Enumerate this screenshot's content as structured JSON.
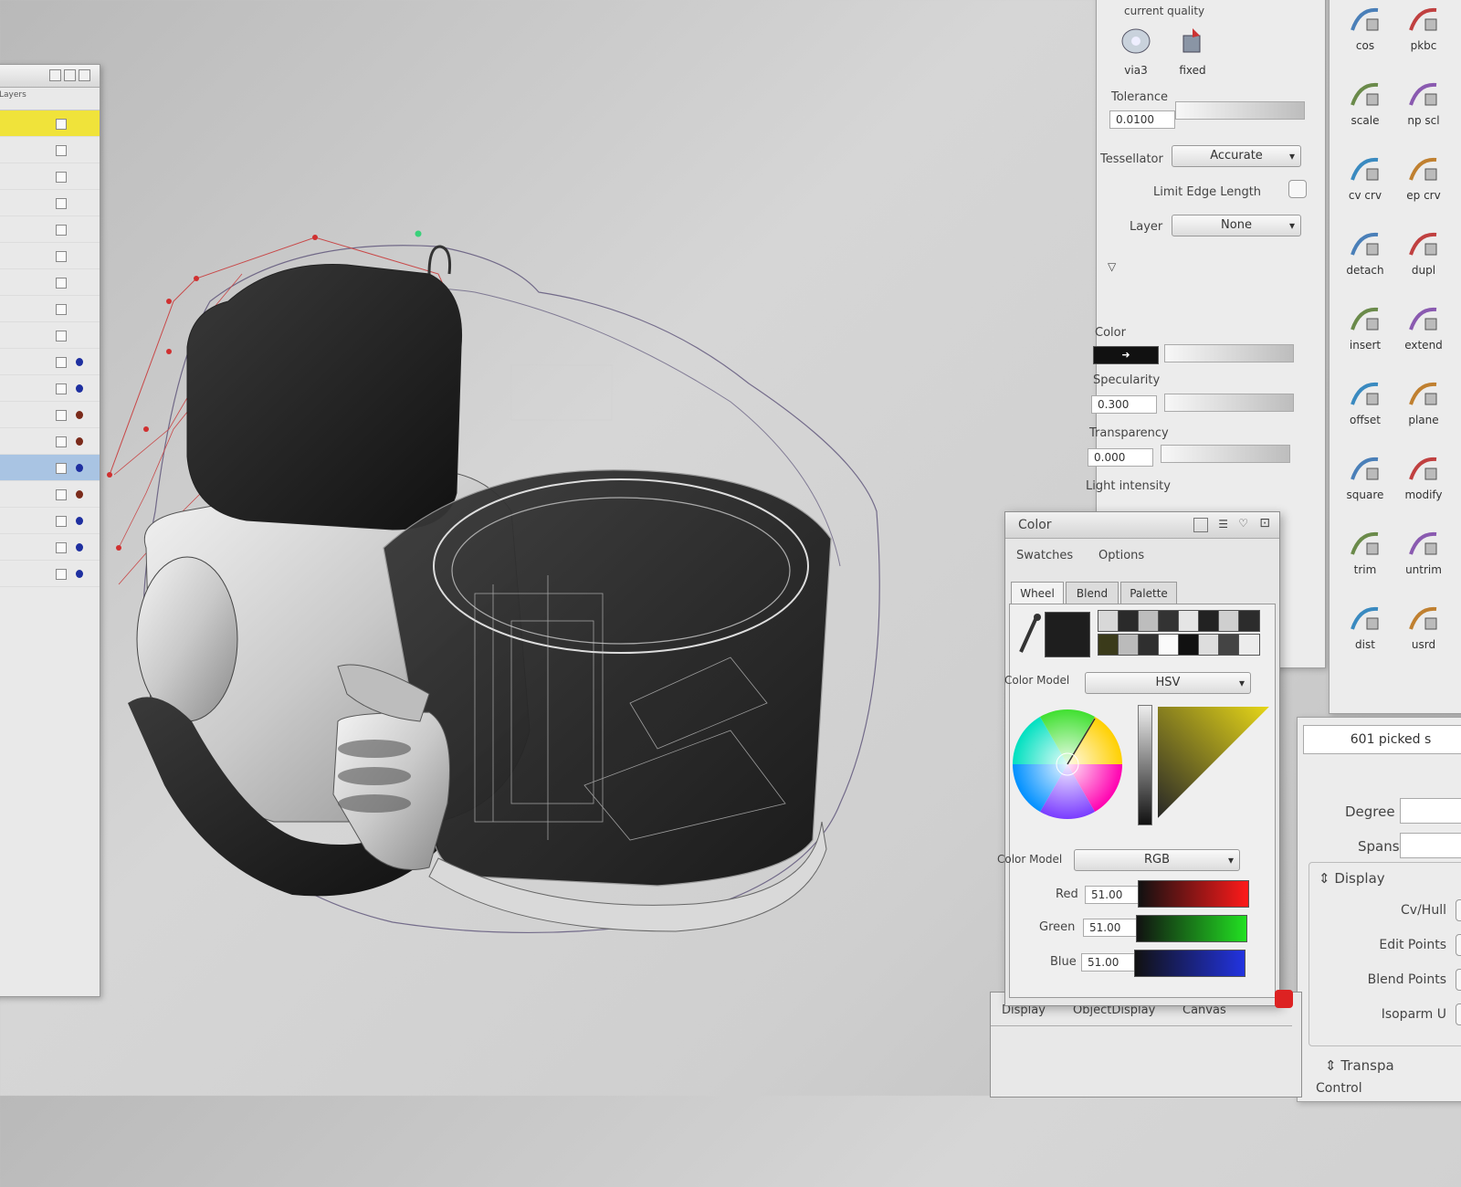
{
  "tessellation": {
    "top_label_partial": "current quality",
    "top_tools": [
      {
        "label": "via3"
      },
      {
        "label": "fixed"
      }
    ],
    "tolerance_label": "Tolerance",
    "tolerance_value": "0.0100",
    "tessellator_label": "Tessellator",
    "tessellator_value": "Accurate",
    "limit_edge_label": "Limit Edge Length",
    "layer_label": "Layer",
    "layer_value": "None"
  },
  "shading": {
    "color_label": "Color",
    "specularity_label": "Specularity",
    "specularity_value": "0.300",
    "transparency_label": "Transparency",
    "transparency_value": "0.000",
    "light_intensity_label": "Light intensity"
  },
  "palette_tools": [
    {
      "label": "cos"
    },
    {
      "label": "pkbc"
    },
    {
      "label": "scale"
    },
    {
      "label": "np scl"
    },
    {
      "label": "cv crv"
    },
    {
      "label": "ep crv"
    },
    {
      "label": "detach"
    },
    {
      "label": "dupl"
    },
    {
      "label": "insert"
    },
    {
      "label": "extend"
    },
    {
      "label": "offset"
    },
    {
      "label": "plane"
    },
    {
      "label": "square"
    },
    {
      "label": "modify"
    },
    {
      "label": "trim"
    },
    {
      "label": "untrim"
    },
    {
      "label": "dist"
    },
    {
      "label": "usrd"
    }
  ],
  "color_window": {
    "title": "Color",
    "menu": [
      "Swatches",
      "Options"
    ],
    "tabs": [
      "Wheel",
      "Blend",
      "Palette"
    ],
    "color_model_label_1": "Color Model",
    "color_model_value_1": "HSV",
    "color_model_label_2": "Color Model",
    "color_model_value_2": "RGB",
    "red_label": "Red",
    "red_value": "51.00",
    "green_label": "Green",
    "green_value": "51.00",
    "blue_label": "Blue",
    "blue_value": "51.00",
    "current_color": "#1e1e1e"
  },
  "bottom_tabs": [
    "Display",
    "ObjectDisplay",
    "Canvas"
  ],
  "info_panel": {
    "picked_text": "601 picked s",
    "degree_label": "Degree",
    "spans_label": "Spans",
    "display_section": "Display",
    "display_options": [
      "Cv/Hull",
      "Edit Points",
      "Blend Points",
      "Isoparm U"
    ],
    "transparency_section": "Transpa",
    "bottom_partial": "Control"
  },
  "layer_panel": {
    "header": "Layers",
    "dot_colors": [
      "",
      "",
      "",
      "",
      "",
      "",
      "",
      "",
      "",
      "#1e2fa0",
      "#1e2fa0",
      "#7a2a1a",
      "#7a2a1a",
      "#1e2fa0",
      "#7a2a1a",
      "#1e2fa0",
      "#1e2fa0",
      "#1e2fa0"
    ]
  }
}
